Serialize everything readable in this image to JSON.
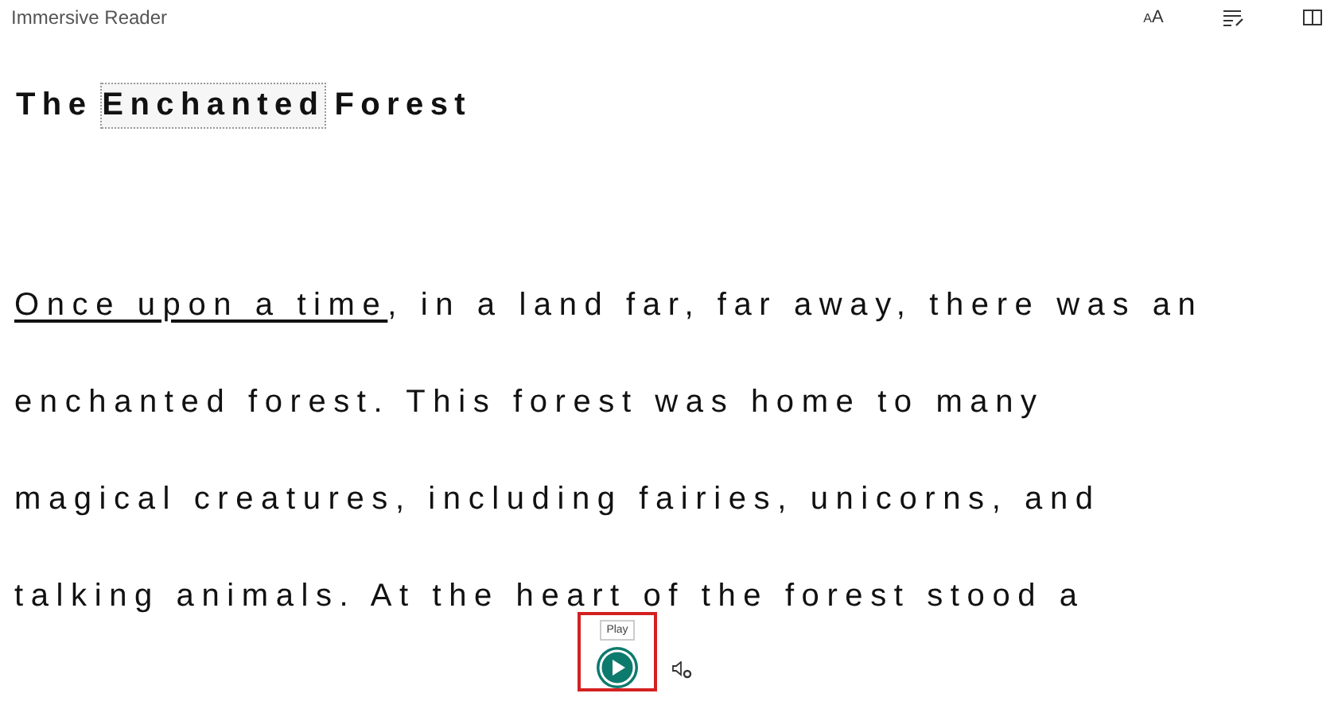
{
  "app": {
    "title": "Immersive Reader"
  },
  "toolbar": [
    {
      "kind": "text-size",
      "glyph": "AA"
    },
    {
      "kind": "grammar"
    },
    {
      "kind": "reading"
    }
  ],
  "document": {
    "title_words": [
      {
        "text": "The",
        "focused": false
      },
      {
        "text": "Enchanted",
        "focused": true
      },
      {
        "text": "Forest",
        "focused": false
      }
    ],
    "lines": [
      [
        {
          "text": "Once upon a time",
          "underlined": true
        },
        {
          "text": ", in a land far, far away, there was an",
          "underlined": false
        }
      ],
      [
        {
          "text": "enchanted forest. This forest was home to many",
          "underlined": false
        }
      ],
      [
        {
          "text": "magical creatures, including fairies, unicorns, and",
          "underlined": false
        }
      ],
      [
        {
          "text": "talking animals. At the heart of the forest stood a",
          "underlined": false
        }
      ]
    ]
  },
  "player": {
    "tooltip": "Play",
    "playing": false
  }
}
